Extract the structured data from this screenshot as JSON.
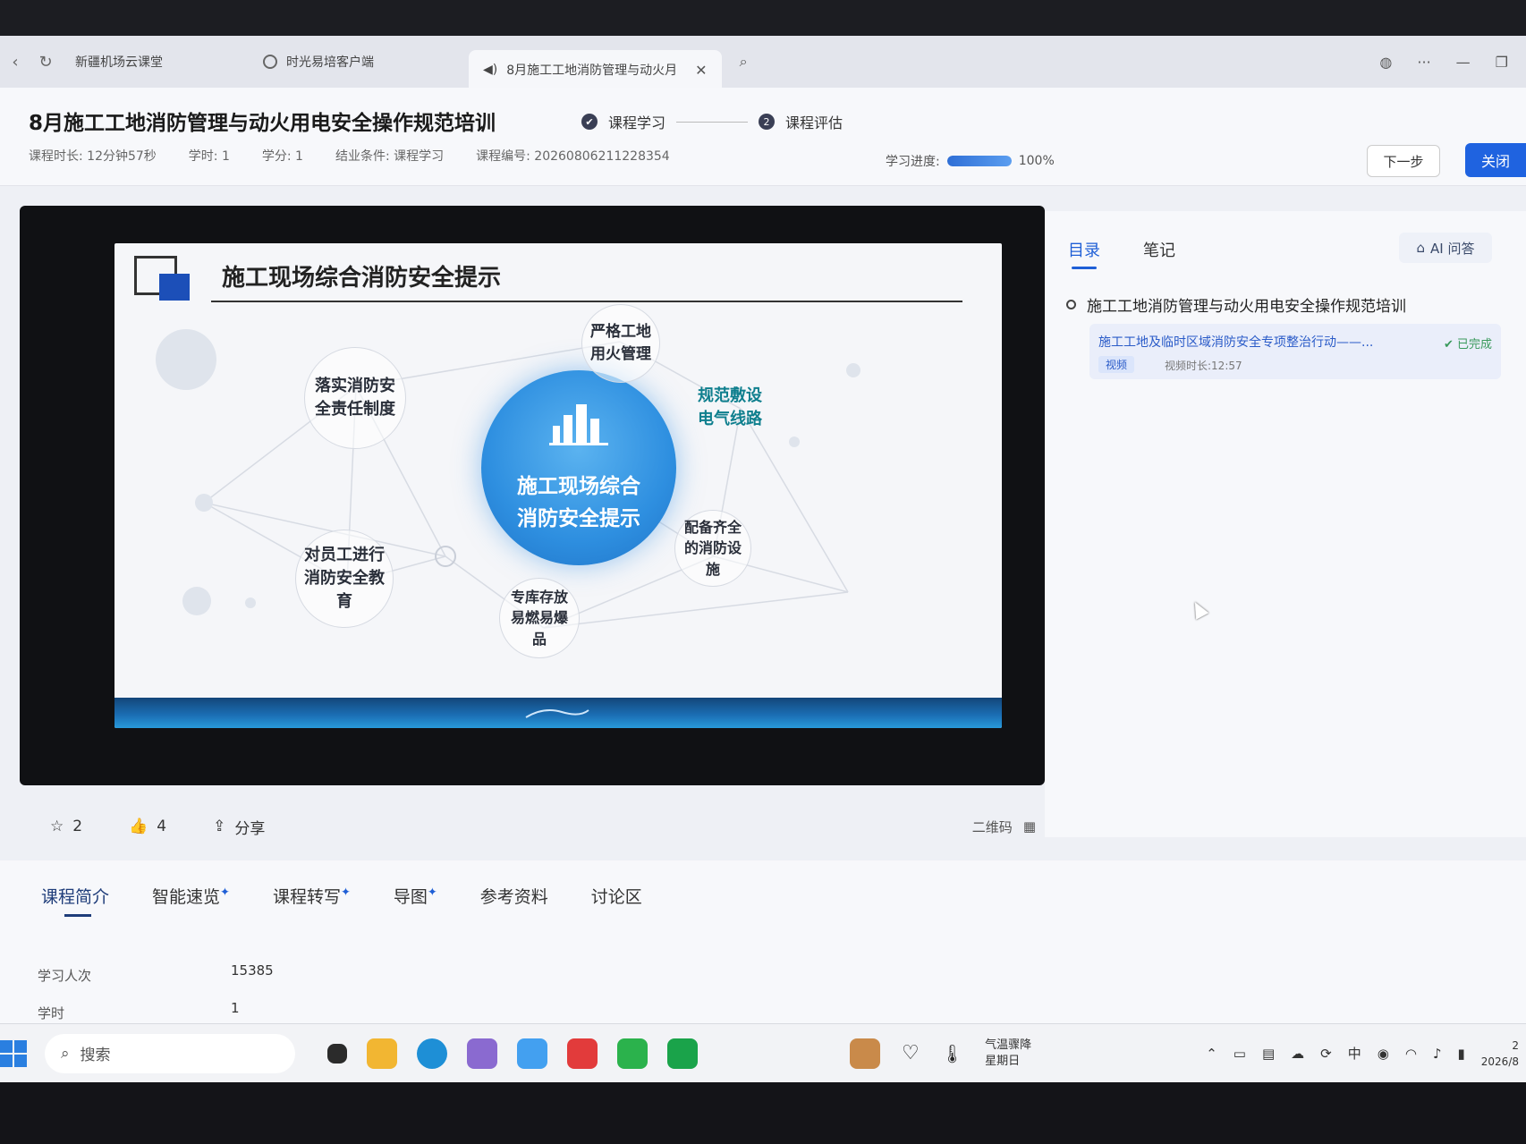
{
  "browser": {
    "tabs": [
      {
        "label": "新疆机场云课堂"
      },
      {
        "label": "时光易培客户端"
      },
      {
        "label": "8月施工工地消防管理与动火月"
      }
    ]
  },
  "course": {
    "title": "8月施工工地消防管理与动火用电安全操作规范培训",
    "steps": [
      {
        "num": "✔",
        "label": "课程学习"
      },
      {
        "num": "2",
        "label": "课程评估"
      }
    ],
    "meta": [
      "课程时长: 12分钟57秒",
      "学时: 1",
      "学分: 1",
      "结业条件: 课程学习",
      "课程编号: 20260806211228354"
    ],
    "progress_label": "学习进度:",
    "progress_value": 100,
    "progress_text": "100%",
    "next_label": "下一步",
    "close_label": "关闭"
  },
  "slide": {
    "title": "施工现场综合消防安全提示",
    "center": "施工现场综合消防安全提示",
    "nodes": [
      {
        "text": "严格工地用火管理"
      },
      {
        "text": "规范敷设电气线路"
      },
      {
        "text": "配备齐全的消防设施"
      },
      {
        "text": "专库存放易燃易爆品"
      },
      {
        "text": "对员工进行消防安全教育"
      },
      {
        "text": "落实消防安全责任制度"
      }
    ]
  },
  "player_bar": {
    "favorites": "2",
    "likes": "4",
    "share": "分享",
    "qr": "二维码"
  },
  "side": {
    "tabs": [
      "目录",
      "笔记"
    ],
    "ai_label": "AI 问答",
    "outline_title": "施工工地消防管理与动火用电安全操作规范培训",
    "lesson": {
      "name": "施工工地及临时区域消防安全专项整治行动——...",
      "status": "✔ 已完成",
      "tag": "视频",
      "duration": "视频时长:12:57"
    }
  },
  "bottom_tabs": [
    "课程简介",
    "智能速览",
    "课程转写",
    "导图",
    "参考资料",
    "讨论区"
  ],
  "info": [
    {
      "label": "学习人次",
      "value": "15385"
    },
    {
      "label": "学时",
      "value": "1"
    }
  ],
  "taskbar": {
    "search_placeholder": "搜索",
    "weather_line1": "气温骤降",
    "weather_line2": "星期日",
    "ime": "中",
    "clock_time": "2",
    "clock_date": "2026/8"
  },
  "colors": {
    "accent": "#1f63e0",
    "slide_blue": "#2e8fe0",
    "done_green": "#3a9a5c"
  }
}
